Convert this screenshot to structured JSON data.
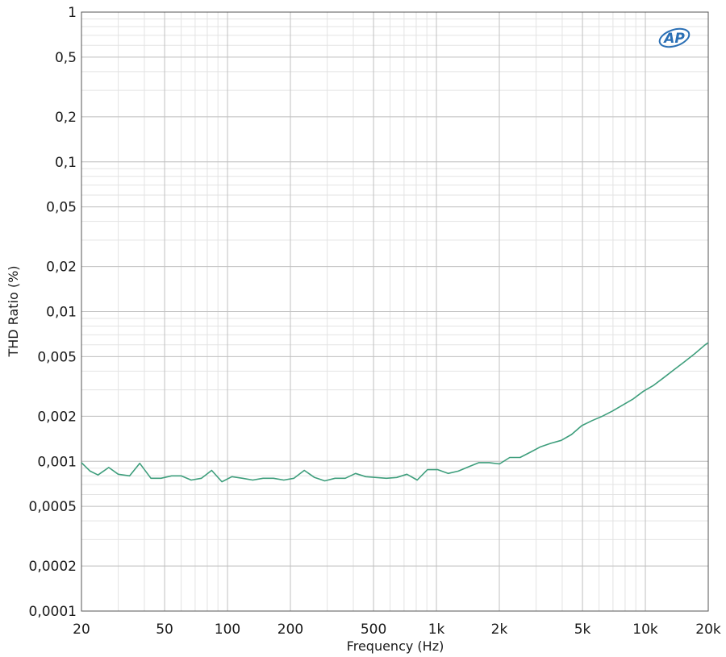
{
  "chart_data": {
    "type": "line",
    "x_scale": "log",
    "y_scale": "log",
    "xlabel": "Frequency (Hz)",
    "ylabel": "THD Ratio (%)",
    "xlim": [
      20,
      20000
    ],
    "ylim": [
      0.0001,
      1
    ],
    "grid": true,
    "logo": "AP",
    "line_color": "#3e9e7c",
    "x_ticks": [
      {
        "value": 20,
        "label": "20"
      },
      {
        "value": 50,
        "label": "50"
      },
      {
        "value": 100,
        "label": "100"
      },
      {
        "value": 200,
        "label": "200"
      },
      {
        "value": 500,
        "label": "500"
      },
      {
        "value": 1000,
        "label": "1k"
      },
      {
        "value": 2000,
        "label": "2k"
      },
      {
        "value": 5000,
        "label": "5k"
      },
      {
        "value": 10000,
        "label": "10k"
      },
      {
        "value": 20000,
        "label": "20k"
      }
    ],
    "y_ticks": [
      {
        "value": 1,
        "label": "1"
      },
      {
        "value": 0.5,
        "label": "0,5"
      },
      {
        "value": 0.2,
        "label": "0,2"
      },
      {
        "value": 0.1,
        "label": "0,1"
      },
      {
        "value": 0.05,
        "label": "0,05"
      },
      {
        "value": 0.02,
        "label": "0,02"
      },
      {
        "value": 0.01,
        "label": "0,01"
      },
      {
        "value": 0.005,
        "label": "0,005"
      },
      {
        "value": 0.002,
        "label": "0,002"
      },
      {
        "value": 0.001,
        "label": "0,001"
      },
      {
        "value": 0.0005,
        "label": "0,0005"
      },
      {
        "value": 0.0002,
        "label": "0,0002"
      },
      {
        "value": 0.0001,
        "label": "0,0001"
      }
    ],
    "series": [
      {
        "x": [
          20,
          22,
          24,
          27,
          30,
          34,
          38,
          43,
          48,
          54,
          60,
          67,
          75,
          84,
          94,
          105,
          118,
          132,
          148,
          166,
          186,
          208,
          233,
          261,
          292,
          327,
          366,
          410,
          459,
          514,
          576,
          645,
          722,
          809,
          906,
          1015,
          1137,
          1273,
          1426,
          1597,
          1789,
          2003,
          2244,
          2513,
          2815,
          3153,
          3531,
          3955,
          4430,
          4961,
          5557,
          6224,
          6971,
          7808,
          8745,
          9794,
          10970,
          12287,
          13761,
          15413,
          17263,
          19335,
          20000
        ],
        "y": [
          0.00098,
          0.00086,
          0.00081,
          0.00091,
          0.00082,
          0.0008,
          0.00097,
          0.00077,
          0.00077,
          0.0008,
          0.0008,
          0.00075,
          0.00077,
          0.00087,
          0.00073,
          0.00079,
          0.00077,
          0.00075,
          0.00077,
          0.00077,
          0.00075,
          0.00077,
          0.00087,
          0.00078,
          0.00074,
          0.00077,
          0.00077,
          0.00083,
          0.00079,
          0.00078,
          0.00077,
          0.00078,
          0.00082,
          0.00075,
          0.00088,
          0.00088,
          0.00083,
          0.00086,
          0.00092,
          0.00098,
          0.00098,
          0.00096,
          0.00106,
          0.00106,
          0.00115,
          0.00125,
          0.00132,
          0.00138,
          0.00151,
          0.00173,
          0.00187,
          0.002,
          0.00217,
          0.00238,
          0.00261,
          0.00294,
          0.00322,
          0.00363,
          0.0041,
          0.00463,
          0.00524,
          0.006,
          0.0062
        ]
      }
    ]
  }
}
